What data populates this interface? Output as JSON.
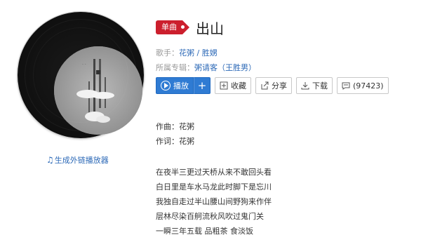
{
  "album": {
    "cover_icon": "album-cover-image",
    "external_player_link": "生成外链播放器"
  },
  "song": {
    "badge": "单曲",
    "title": "出山"
  },
  "meta": {
    "singer_label": "歌手：",
    "singer_value": "花粥 / 胜娚",
    "album_label": "所属专辑：",
    "album_value": "粥请客（王胜男）"
  },
  "buttons": {
    "play": "播放",
    "add": "+",
    "collect": "收藏",
    "share": "分享",
    "download": "下载",
    "comments": "(97423)"
  },
  "lyrics": {
    "composer": "作曲：花粥",
    "lyricist": "作词：花粥",
    "lines": [
      "在夜半三更过天桥从来不敢回头看",
      "白日里是车水马龙此时脚下是忘川",
      "我独自走过半山腰山间野狗来作伴",
      "层林尽染百舸流秋风吹过鬼门关",
      "一瞬三年五载 品粗茶 食淡饭"
    ]
  },
  "colors": {
    "accent": "#2f7bd3",
    "badge": "#cc1f2d",
    "link": "#2c69b7"
  }
}
